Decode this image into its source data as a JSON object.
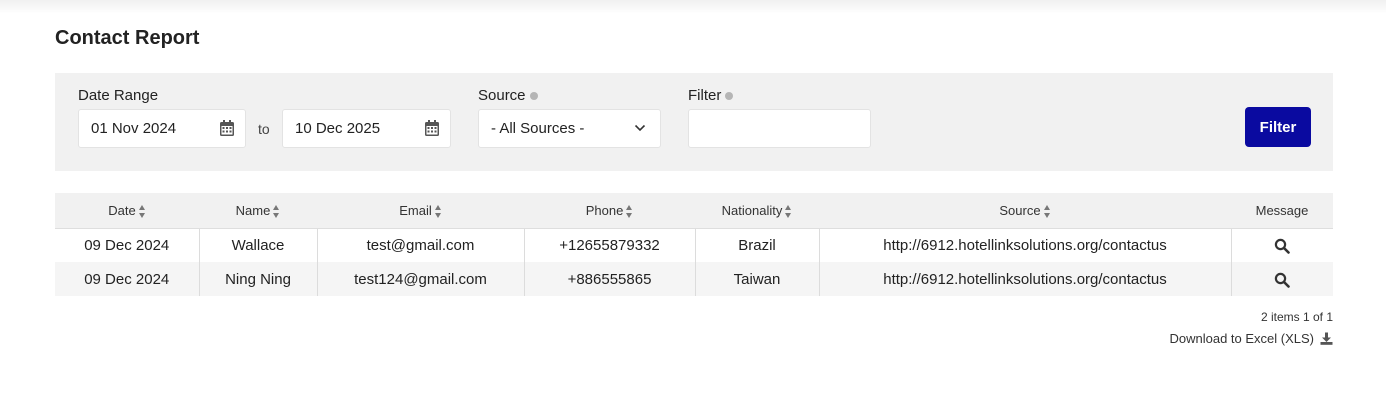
{
  "page": {
    "title": "Contact Report"
  },
  "filters": {
    "date_range_label": "Date Range",
    "date_from": "01 Nov 2024",
    "to_label": "to",
    "date_to": "10 Dec 2025",
    "source_label": "Source",
    "source_selected": "- All Sources -",
    "filter_label": "Filter",
    "filter_value": "",
    "filter_button": "Filter"
  },
  "table": {
    "headers": {
      "date": "Date",
      "name": "Name",
      "email": "Email",
      "phone": "Phone",
      "nationality": "Nationality",
      "source": "Source",
      "message": "Message"
    },
    "rows": [
      {
        "date": "09 Dec 2024",
        "name": "Wallace",
        "email": "test@gmail.com",
        "phone": "+12655879332",
        "nationality": "Brazil",
        "source": "http://6912.hotellinksolutions.org/contactus"
      },
      {
        "date": "09 Dec 2024",
        "name": "Ning Ning",
        "email": "test124@gmail.com",
        "phone": "+886555865",
        "nationality": "Taiwan",
        "source": "http://6912.hotellinksolutions.org/contactus"
      }
    ]
  },
  "footer": {
    "pager": "2 items 1 of 1",
    "download_label": "Download to Excel (XLS)"
  },
  "colors": {
    "primary_button": "#0a0aa0",
    "panel_bg": "#f1f1f1"
  },
  "icons": [
    "calendar-icon",
    "chevron-down-icon",
    "info-icon",
    "sort-icon",
    "search-icon",
    "download-icon"
  ]
}
